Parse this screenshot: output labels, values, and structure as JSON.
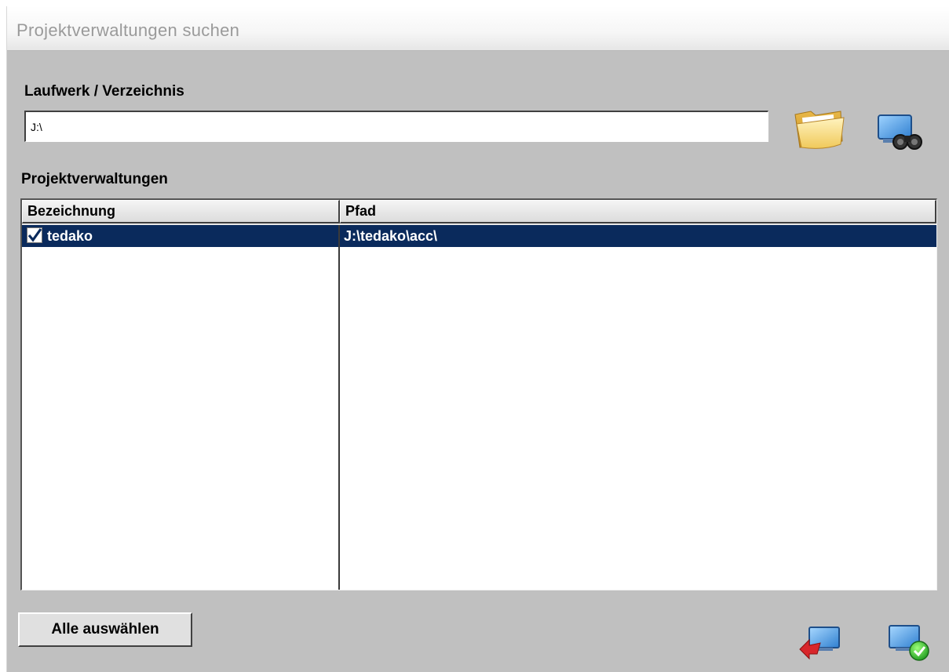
{
  "window": {
    "title": "Projektverwaltungen suchen"
  },
  "directory": {
    "label": "Laufwerk / Verzeichnis",
    "value": "J:\\"
  },
  "icons": {
    "browse": "folder-icon",
    "search": "binoculars-search-icon",
    "cancel": "back-arrow-cancel-icon",
    "confirm": "checkmark-confirm-icon"
  },
  "list": {
    "label": "Projektverwaltungen",
    "columns": [
      "Bezeichnung",
      "Pfad"
    ],
    "rows": [
      {
        "checked": true,
        "name": "tedako",
        "path": "J:\\tedako\\acc\\"
      }
    ]
  },
  "footer": {
    "select_all_label": "Alle auswählen"
  },
  "colors": {
    "window_bg": "#c0c0c0",
    "selection": "#0a2a5c"
  }
}
